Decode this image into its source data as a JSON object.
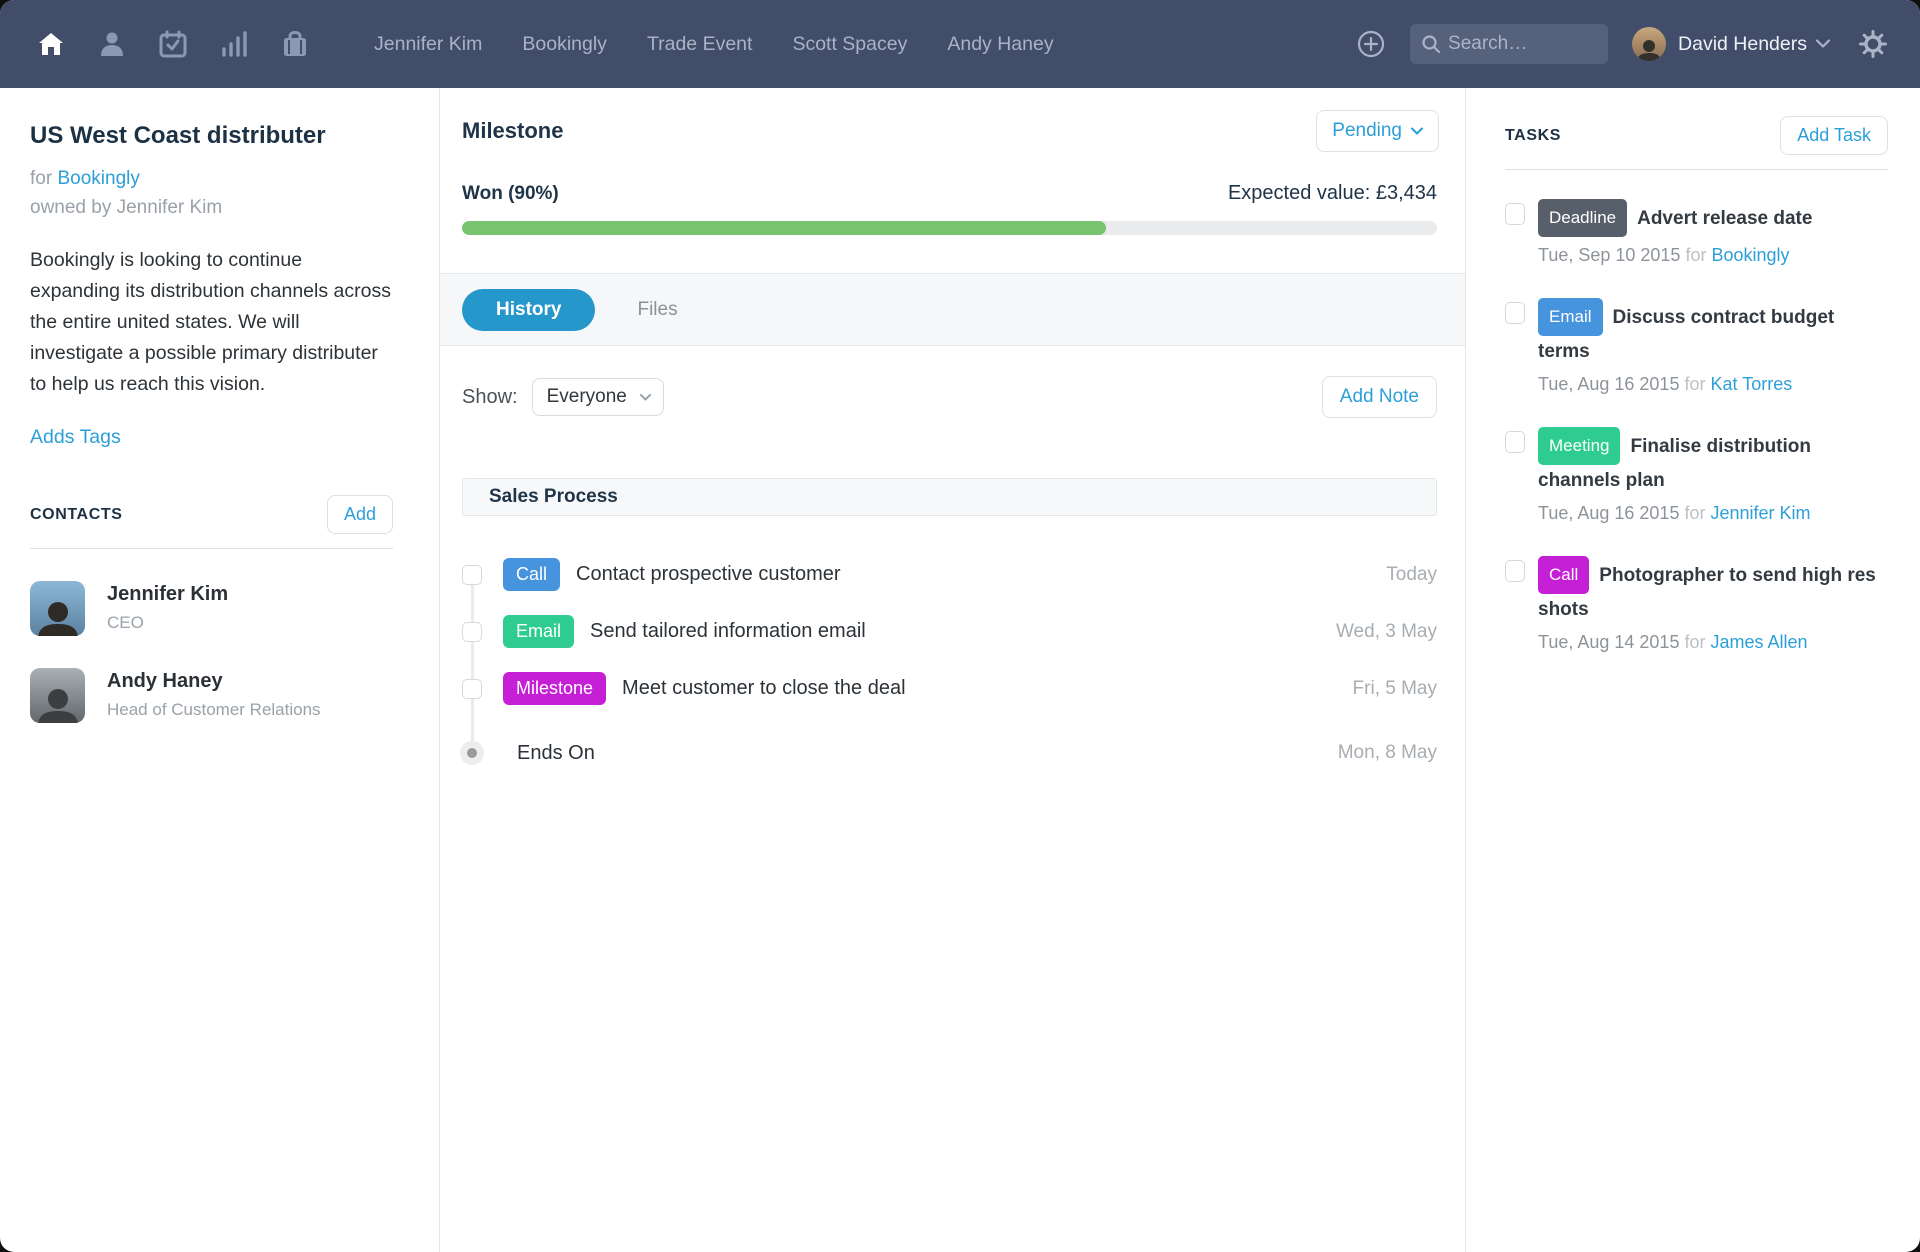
{
  "topbar": {
    "nav_icons": [
      "home",
      "contacts",
      "calendar",
      "statistics",
      "cases"
    ],
    "nav_items": [
      "Jennifer Kim",
      "Bookingly",
      "Trade Event",
      "Scott Spacey",
      "Andy Haney"
    ],
    "search_placeholder": "Search…",
    "user_name": "David Henders"
  },
  "left_panel": {
    "title": "US West Coast distributer",
    "for_label": "for",
    "for_link": "Bookingly",
    "owned_by": "owned by Jennifer Kim",
    "description": "Bookingly is looking to continue expanding its distribution channels across the entire united states. We will investigate a possible primary distributer to help us reach this vision.",
    "tags_link": "Adds Tags",
    "contacts_heading": "CONTACTS",
    "contacts_add_button": "Add",
    "contacts": [
      {
        "name": "Jennifer Kim",
        "role": "CEO"
      },
      {
        "name": "Andy Haney",
        "role": "Head of Customer Relations"
      }
    ]
  },
  "main": {
    "title": "Milestone",
    "status_button": "Pending",
    "progress": {
      "label": "Won (90%)",
      "expected": "Expected value: £3,434",
      "fill": "66%",
      "fill_color": "#77c46f"
    },
    "tabs": {
      "history": "History",
      "files": "Files"
    },
    "show_label": "Show:",
    "show_value": "Everyone",
    "add_note_button": "Add Note",
    "section_title": "Sales Process",
    "steps": [
      {
        "badge": "Call",
        "badge_color": "#4693de",
        "title": "Contact prospective customer",
        "date": "Today"
      },
      {
        "badge": "Email",
        "badge_color": "#2ecc8e",
        "title": "Send tailored information email",
        "date": "Wed, 3 May"
      },
      {
        "badge": "Milestone",
        "badge_color": "#c520d5",
        "title": "Meet customer to close the deal",
        "date": "Fri, 5 May"
      }
    ],
    "ends_on": {
      "title": "Ends On",
      "date": "Mon, 8 May"
    }
  },
  "tasks_panel": {
    "heading": "TASKS",
    "add_button": "Add Task",
    "items": [
      {
        "badge": "Deadline",
        "badge_color": "#565f6a",
        "title": "Advert release date",
        "date": "Tue, Sep 10 2015",
        "for_label": "for",
        "for_link": "Bookingly"
      },
      {
        "badge": "Email",
        "badge_color": "#4693de",
        "title": "Discuss contract budget terms",
        "date": "Tue, Aug 16 2015",
        "for_label": "for",
        "for_link": "Kat Torres"
      },
      {
        "badge": "Meeting",
        "badge_color": "#2ecc8e",
        "title": "Finalise distribution channels plan",
        "date": "Tue, Aug 16 2015",
        "for_label": "for",
        "for_link": "Jennifer Kim"
      },
      {
        "badge": "Call",
        "badge_color": "#c520d5",
        "title": "Photographer to send high res shots",
        "date": "Tue, Aug 14 2015",
        "for_label": "for",
        "for_link": "James Allen"
      }
    ]
  }
}
